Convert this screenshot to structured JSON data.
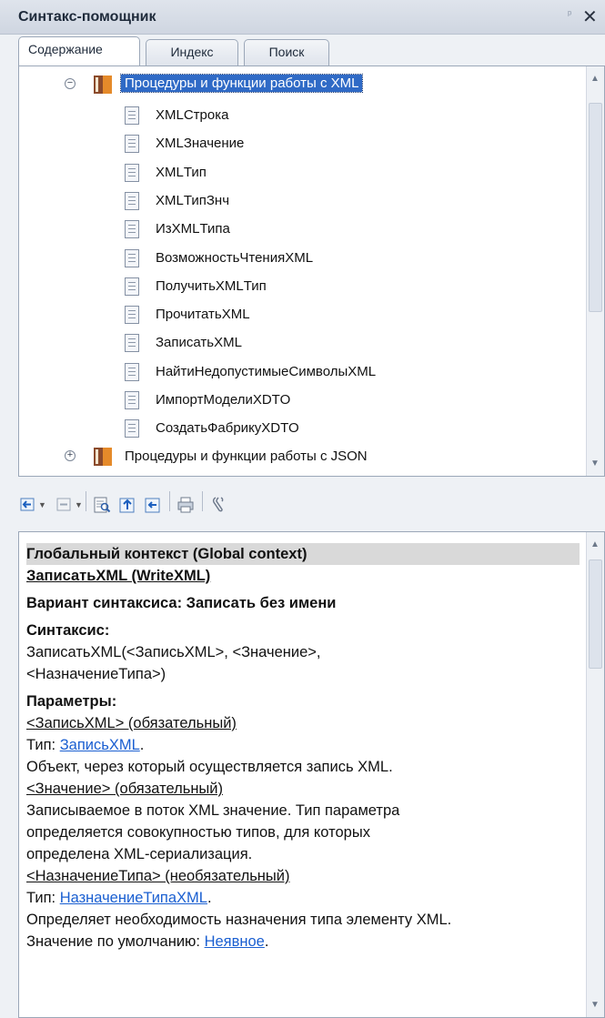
{
  "window": {
    "title": "Синтакс-помощник",
    "pin_glyph": "ᵖ",
    "close_glyph": "✕"
  },
  "tabs": [
    "Содержание",
    "Индекс",
    "Поиск"
  ],
  "tree": {
    "folder_open": "Процедуры и функции работы с XML",
    "items": [
      "XMLСтрока",
      "XMLЗначение",
      "XMLТип",
      "XMLТипЗнч",
      "ИзXMLТипа",
      "ВозможностьЧтенияXML",
      "ПолучитьXMLТип",
      "ПрочитатьXML",
      "ЗаписатьXML",
      "НайтиНедопустимыеСимволыXML",
      "ИмпортМоделиXDTO",
      "СоздатьФабрикуXDTO"
    ],
    "folder_closed": "Процедуры и функции работы с JSON",
    "expand_minus": "−",
    "expand_plus": "+"
  },
  "toolbar": {
    "icons": [
      "back-icon",
      "forward-icon",
      "find-in-content-icon",
      "previous-topic-icon",
      "next-topic-icon",
      "print-icon",
      "settings-icon"
    ]
  },
  "content": {
    "context": "Глобальный контекст (Global context)",
    "method": "ЗаписатьXML (WriteXML)",
    "variant": "Вариант синтаксиса: Записать без имени",
    "syntax_label": "Синтаксис:",
    "syntax_line1": "ЗаписатьXML(<ЗаписьXML>, <Значение>,",
    "syntax_line2": "<НазначениеТипа>)",
    "params_label": "Параметры:",
    "p1_name": "<ЗаписьXML> (обязательный)",
    "p1_type_prefix": "Тип: ",
    "p1_type_link": "ЗаписьXML",
    "p1_type_suffix": ".",
    "p1_desc": "Объект, через который осуществляется запись XML.",
    "p2_name": "<Значение> (обязательный)",
    "p2_desc1": "Записываемое в поток XML значение. Тип параметра",
    "p2_desc2": "определяется совокупностью типов, для которых",
    "p2_desc3": "определена XML-сериализация.",
    "p3_name": "<НазначениеТипа> (необязательный)",
    "p3_type_prefix": "Тип: ",
    "p3_type_link": "НазначениеТипаXML",
    "p3_type_suffix": ".",
    "p3_desc": "Определяет необходимость назначения типа элементу XML.",
    "p3_default_prefix": "Значение по умолчанию: ",
    "p3_default_link": "Неявное",
    "p3_default_suffix": "."
  },
  "scroll_arrows": {
    "up": "▲",
    "down": "▼"
  },
  "colors": {
    "selection": "#2f6ac6",
    "link": "#1a5fd1",
    "header_bg": "#d9d9d9"
  }
}
